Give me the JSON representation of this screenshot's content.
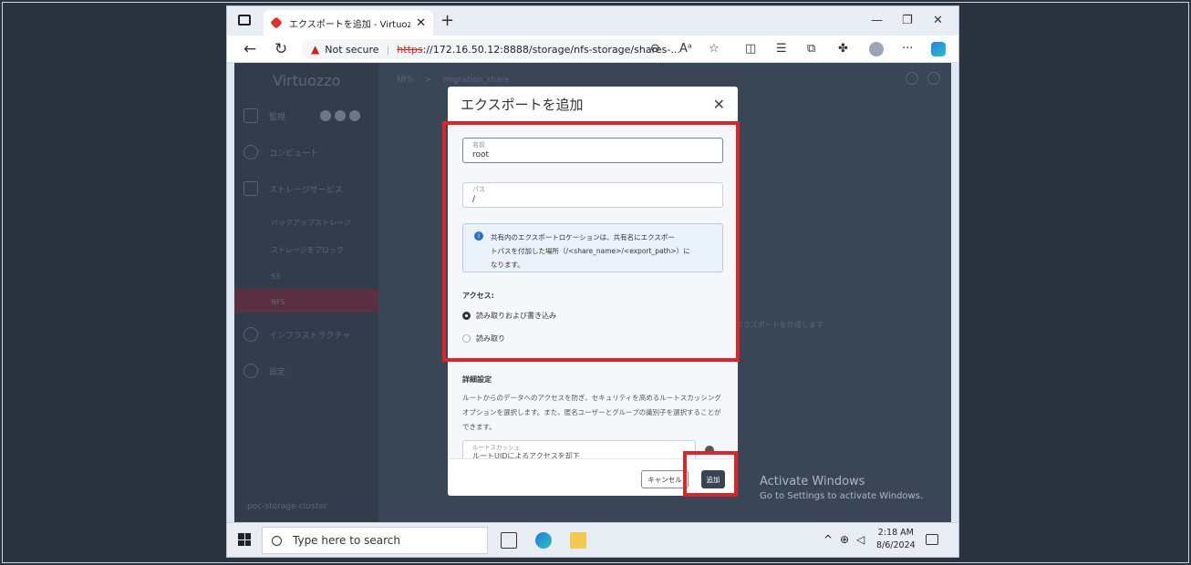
{
  "browser": {
    "tab_title": "エクスポートを追加 - Virtuozzo Hyb",
    "security_label": "Not secure",
    "url_scheme": "https",
    "url_rest": "://172.16.50.12:8888/storage/nfs-storage/shares-..."
  },
  "app": {
    "brand": "Virtuozzo",
    "sidebar": {
      "monitoring": "監視",
      "compute": "コンピュート",
      "storage_services": "ストレージサービス",
      "backup_storage": "バックアップストレージ",
      "block_storage": "ストレージをブロック",
      "s3": "S3",
      "nfs": "NFS",
      "infrastructure": "インフラストラクチャ",
      "settings": "設定",
      "cluster": "poc-storage-cluster"
    },
    "breadcrumb": {
      "root": "NFS",
      "separator": ">",
      "current": "migration_share"
    },
    "background_text": "エクスポートを作成します"
  },
  "dialog": {
    "title": "エクスポートを追加",
    "name_label": "名前",
    "name_value": "root",
    "path_label": "パス",
    "path_value": "/",
    "info_line1": "共有内のエクスポートロケーションは、共有名にエクスポー",
    "info_line2": "トパスを付加した場所（/<share_name>/<export_path>）に",
    "info_line3": "なります。",
    "access_title": "アクセス:",
    "access_rw": "読み取りおよび書き込み",
    "access_ro": "読み取り",
    "advanced_title": "詳細設定",
    "advanced_desc": "ルートからのデータへのアクセスを防ぎ、セキュリティを高めるルートスカッシングオプションを選択します。また、匿名ユーザーとグループの識別子を選択することができます。",
    "squash_label": "ルートスカッシュ",
    "squash_value": "ルートUIDによるアクセスを却下",
    "cancel": "キャンセル",
    "add": "追加"
  },
  "watermark": {
    "title": "Activate Windows",
    "subtitle": "Go to Settings to activate Windows."
  },
  "taskbar": {
    "search_placeholder": "Type here to search",
    "time": "2:18 AM",
    "date": "8/6/2024"
  }
}
